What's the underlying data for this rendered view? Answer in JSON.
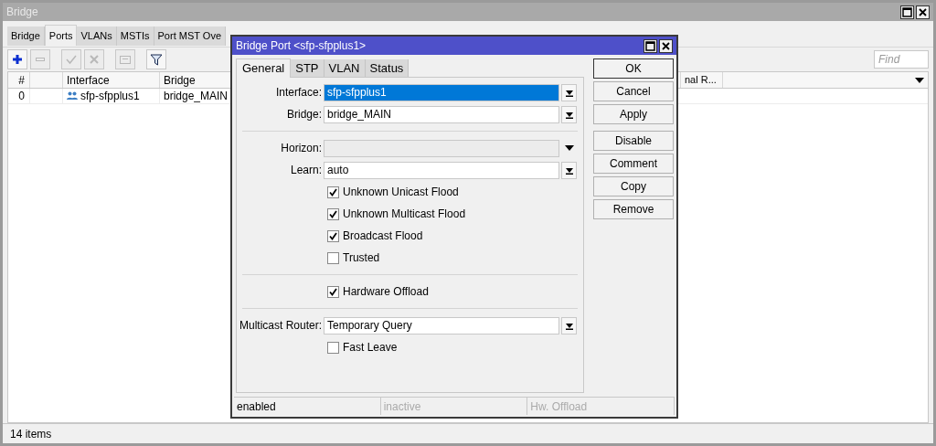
{
  "window": {
    "title": "Bridge"
  },
  "tabs": [
    {
      "label": "Bridge",
      "selected": false
    },
    {
      "label": "Ports",
      "selected": true
    },
    {
      "label": "VLANs",
      "selected": false
    },
    {
      "label": "MSTIs",
      "selected": false
    },
    {
      "label": "Port MST Ove",
      "selected": false
    }
  ],
  "toolbar": [
    {
      "kind": "add",
      "disabled": false
    },
    {
      "kind": "remove",
      "disabled": true
    },
    {
      "kind": "enable",
      "disabled": true
    },
    {
      "kind": "disable",
      "disabled": true
    },
    {
      "kind": "comment",
      "disabled": true
    },
    {
      "kind": "filter",
      "disabled": false
    }
  ],
  "find": {
    "placeholder": "Find"
  },
  "table": {
    "columns": [
      "#",
      "Interface",
      "Bridge"
    ],
    "partial_column": "nal R...",
    "rows": [
      {
        "number": "0",
        "interface": "sfp-sfpplus1",
        "bridge": "bridge_MAIN"
      }
    ]
  },
  "status_bar": "14 items",
  "dialog": {
    "title": "Bridge Port <sfp-sfpplus1>",
    "tabs": [
      {
        "label": "General",
        "selected": true
      },
      {
        "label": "STP",
        "selected": false
      },
      {
        "label": "VLAN",
        "selected": false
      },
      {
        "label": "Status",
        "selected": false
      }
    ],
    "fields": [
      {
        "kind": "select",
        "label": "Interface:",
        "value": "sfp-sfpplus1",
        "highlighted": true
      },
      {
        "kind": "select",
        "label": "Bridge:",
        "value": "bridge_MAIN",
        "highlighted": false
      },
      {
        "kind": "separator"
      },
      {
        "kind": "dropdown",
        "label": "Horizon:"
      },
      {
        "kind": "select",
        "label": "Learn:",
        "value": "auto",
        "highlighted": false
      },
      {
        "kind": "checkbox",
        "label": "Unknown Unicast Flood",
        "checked": true
      },
      {
        "kind": "checkbox",
        "label": "Unknown Multicast Flood",
        "checked": true
      },
      {
        "kind": "checkbox",
        "label": "Broadcast Flood",
        "checked": true
      },
      {
        "kind": "checkbox",
        "label": "Trusted",
        "checked": false
      },
      {
        "kind": "separator"
      },
      {
        "kind": "checkbox",
        "label": "Hardware Offload",
        "checked": true
      },
      {
        "kind": "separator"
      },
      {
        "kind": "select",
        "label": "Multicast Router:",
        "value": "Temporary Query",
        "highlighted": false
      },
      {
        "kind": "checkbox",
        "label": "Fast Leave",
        "checked": false
      }
    ],
    "buttons": [
      {
        "label": "OK",
        "default": true
      },
      {
        "label": "Cancel",
        "default": false
      },
      {
        "label": "Apply",
        "default": false
      },
      {
        "label": "Disable",
        "default": false
      },
      {
        "label": "Comment",
        "default": false
      },
      {
        "label": "Copy",
        "default": false
      },
      {
        "label": "Remove",
        "default": false
      }
    ],
    "status": [
      {
        "label": "enabled",
        "active": true
      },
      {
        "label": "inactive",
        "active": false
      },
      {
        "label": "Hw. Offload",
        "active": false
      }
    ]
  }
}
